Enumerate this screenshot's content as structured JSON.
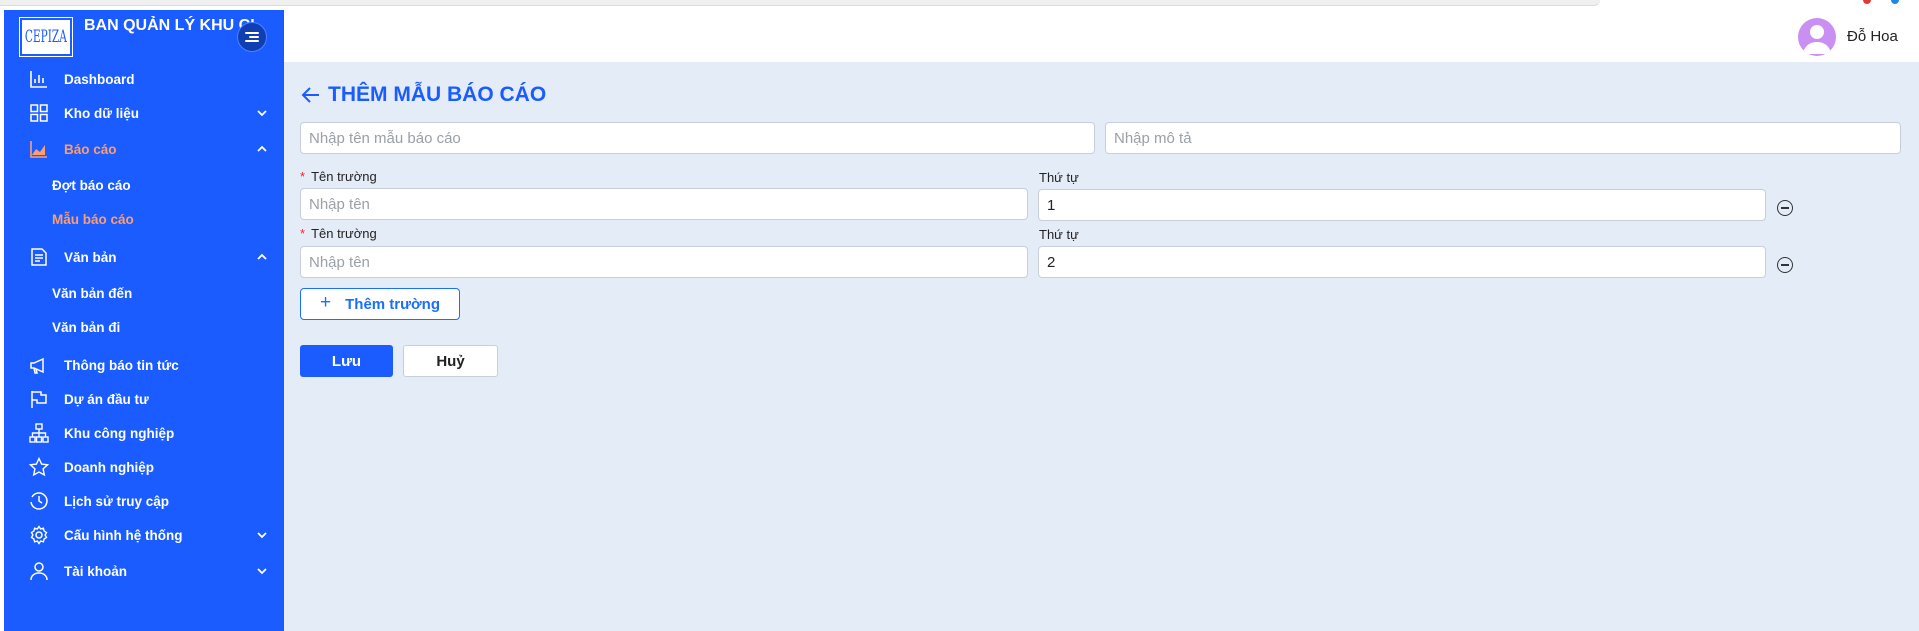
{
  "brand": {
    "logo_text": "CEPIZA",
    "title": "BAN QUẢN LÝ KHU CHẾ XUẤT KHU CN"
  },
  "sidebar": {
    "items": [
      {
        "label": "Dashboard",
        "icon": "bar-chart-icon"
      },
      {
        "label": "Kho dữ liệu",
        "icon": "grid-icon"
      },
      {
        "label": "Báo cáo",
        "icon": "area-chart-icon"
      },
      {
        "label": "Văn bản",
        "icon": "document-icon"
      },
      {
        "label": "Thông báo tin tức",
        "icon": "megaphone-icon"
      },
      {
        "label": "Dự án đầu tư",
        "icon": "flag-icon"
      },
      {
        "label": "Khu công nghiệp",
        "icon": "cluster-icon"
      },
      {
        "label": "Doanh nghiệp",
        "icon": "star-icon"
      },
      {
        "label": "Lịch sử truy cập",
        "icon": "history-icon"
      },
      {
        "label": "Cấu hình hệ thống",
        "icon": "gear-icon"
      },
      {
        "label": "Tài khoản",
        "icon": "user-icon"
      }
    ],
    "bao_cao_sub": [
      "Đợt báo cáo",
      "Mẫu báo cáo"
    ],
    "van_ban_sub": [
      "Văn bản đến",
      "Văn bản đi"
    ]
  },
  "header": {
    "username": "Đỗ Hoa"
  },
  "form": {
    "title": "THÊM MẪU BÁO CÁO",
    "name_placeholder": "Nhập tên mẫu báo cáo",
    "desc_placeholder": "Nhập mô tả",
    "fields": [
      {
        "label": "Tên trường",
        "placeholder": "Nhập tên",
        "order_label": "Thứ tự",
        "order_value": "1"
      },
      {
        "label": "Tên trường",
        "placeholder": "Nhập tên",
        "order_label": "Thứ tự",
        "order_value": "2"
      }
    ],
    "add_field_label": "Thêm trường",
    "save_label": "Lưu",
    "cancel_label": "Huỷ"
  },
  "colors": {
    "sidebar_bg": "#1a5cff",
    "active_text": "#ff9d6c",
    "main_bg": "#e4ecf7",
    "title_color": "#1a5cff"
  }
}
